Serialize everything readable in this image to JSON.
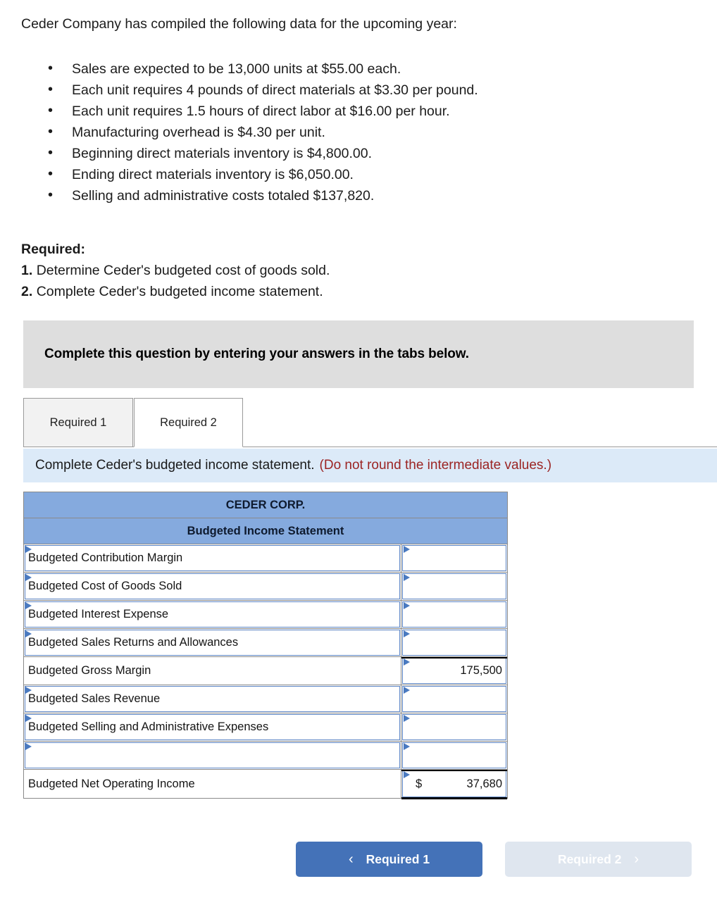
{
  "intro": {
    "paragraph": "Ceder Company has compiled the following data for the upcoming year:"
  },
  "bullets": [
    "Sales are expected to be 13,000 units at $55.00 each.",
    "Each unit requires 4 pounds of direct materials at $3.30 per pound.",
    "Each unit requires 1.5 hours of direct labor at $16.00 per hour.",
    "Manufacturing overhead is $4.30 per unit.",
    "Beginning direct materials inventory is $4,800.00.",
    "Ending direct materials inventory is $6,050.00.",
    "Selling and administrative costs totaled $137,820."
  ],
  "required": {
    "title": "Required:",
    "items": [
      {
        "num": "1.",
        "text": "Determine Ceder's budgeted cost of goods sold."
      },
      {
        "num": "2.",
        "text": "Complete Ceder's budgeted income statement."
      }
    ]
  },
  "banner": {
    "text": "Complete this question by entering your answers in the tabs below."
  },
  "tabs": [
    {
      "label": "Required 1",
      "active": false
    },
    {
      "label": "Required 2",
      "active": true
    }
  ],
  "instruction": {
    "main": "Complete Ceder's budgeted income statement.",
    "note": "(Do not round the intermediate values.)",
    "note_color": "#9b2423"
  },
  "sheet": {
    "company": "CEDER CORP.",
    "statement": "Budgeted Income Statement",
    "header_color": "#85aade",
    "rows": [
      {
        "label": "Budgeted Contribution Margin",
        "value": "",
        "dollar": "",
        "label_dropdown": true,
        "value_dropdown": true,
        "rule": "none"
      },
      {
        "label": "Budgeted Cost of Goods Sold",
        "value": "",
        "dollar": "",
        "label_dropdown": true,
        "value_dropdown": true,
        "rule": "none"
      },
      {
        "label": "Budgeted Interest Expense",
        "value": "",
        "dollar": "",
        "label_dropdown": true,
        "value_dropdown": true,
        "rule": "none"
      },
      {
        "label": "Budgeted Sales Returns and Allowances",
        "value": "",
        "dollar": "",
        "label_dropdown": true,
        "value_dropdown": true,
        "rule": "none"
      },
      {
        "label": "Budgeted Gross Margin",
        "value": "175,500",
        "dollar": "",
        "label_dropdown": false,
        "value_dropdown": true,
        "rule": "top"
      },
      {
        "label": "Budgeted Sales Revenue",
        "value": "",
        "dollar": "",
        "label_dropdown": true,
        "value_dropdown": true,
        "rule": "none"
      },
      {
        "label": "Budgeted Selling and Administrative Expenses",
        "value": "",
        "dollar": "",
        "label_dropdown": true,
        "value_dropdown": true,
        "rule": "none"
      },
      {
        "label": "",
        "value": "",
        "dollar": "",
        "label_dropdown": true,
        "value_dropdown": true,
        "rule": "none"
      },
      {
        "label": "Budgeted Net Operating Income",
        "value": "37,680",
        "dollar": "$",
        "label_dropdown": false,
        "value_dropdown": true,
        "rule": "both"
      }
    ]
  },
  "footer": {
    "prev_label": "Required 1",
    "prev_chevron": "‹",
    "next_label": "Required 2",
    "next_chevron": "›",
    "prev_color": "#4472b8",
    "next_color": "#dfe6ef"
  }
}
